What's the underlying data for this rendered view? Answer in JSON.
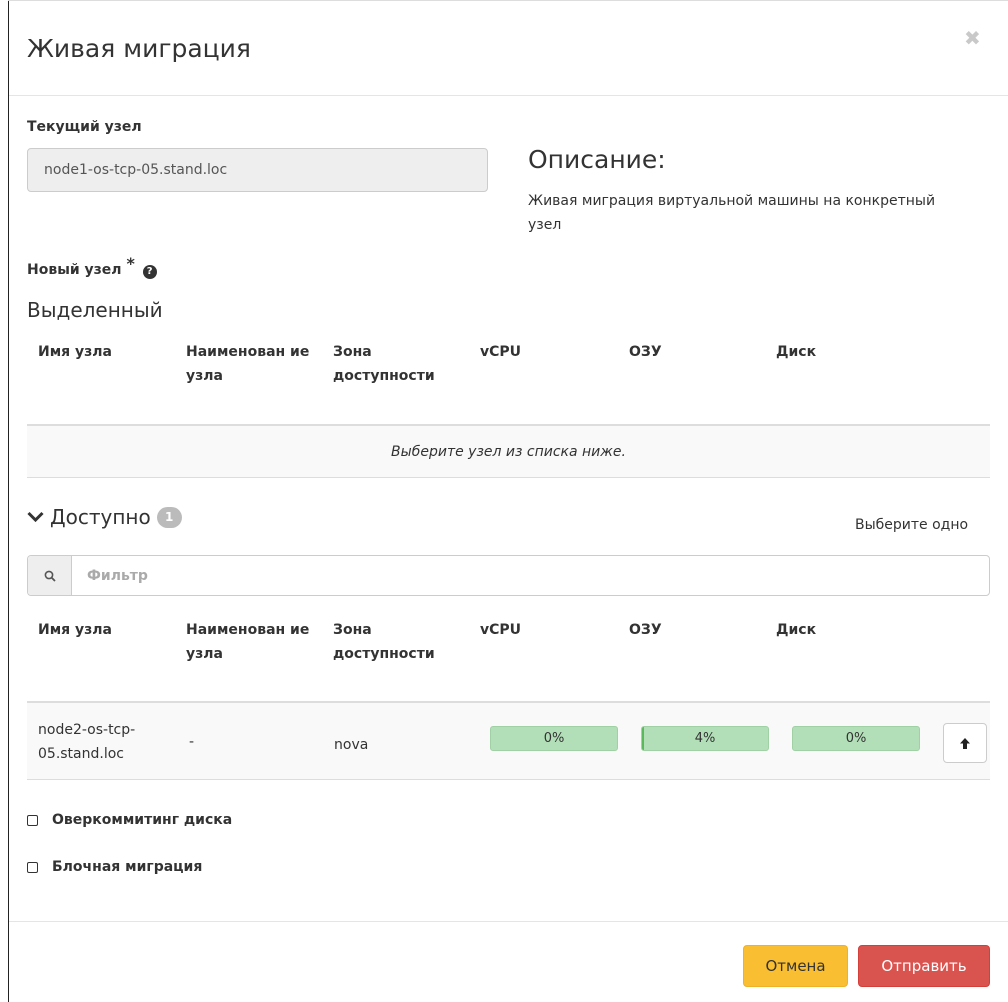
{
  "modal": {
    "title": "Живая миграция",
    "close_icon": "close-icon"
  },
  "current_node": {
    "label": "Текущий узел",
    "value": "node1-os-tcp-05.stand.loc"
  },
  "description": {
    "title": "Описание:",
    "text": "Живая миграция виртуальной машины на конкретный узел"
  },
  "new_node": {
    "label": "Новый узел",
    "required_mark": "*",
    "help_icon": "question-circle-icon"
  },
  "allocated": {
    "title": "Выделенный",
    "columns": [
      "Имя узла",
      "Наименован ие узла",
      "Зона доступности",
      "vCPU",
      "ОЗУ",
      "Диск"
    ],
    "empty_text": "Выберите узел из списка ниже."
  },
  "available": {
    "title": "Доступно",
    "count": "1",
    "select_hint": "Выберите одно",
    "filter_placeholder": "Фильтр",
    "columns": [
      "Имя узла",
      "Наименован ие узла",
      "Зона доступности",
      "vCPU",
      "ОЗУ",
      "Диск"
    ],
    "rows": [
      {
        "host_name": "node2-os-tcp-05.stand.loc",
        "hypervisor_name": "-",
        "zone": "nova",
        "vcpu_label": "0%",
        "vcpu_fraction": 0.0,
        "ram_label": "4%",
        "ram_fraction": 0.01,
        "disk_label": "0%",
        "disk_fraction": 0.0
      }
    ]
  },
  "options": {
    "disk_overcommit": "Оверкоммитинг диска",
    "block_migration": "Блочная миграция"
  },
  "footer": {
    "cancel": "Отмена",
    "submit": "Отправить"
  }
}
